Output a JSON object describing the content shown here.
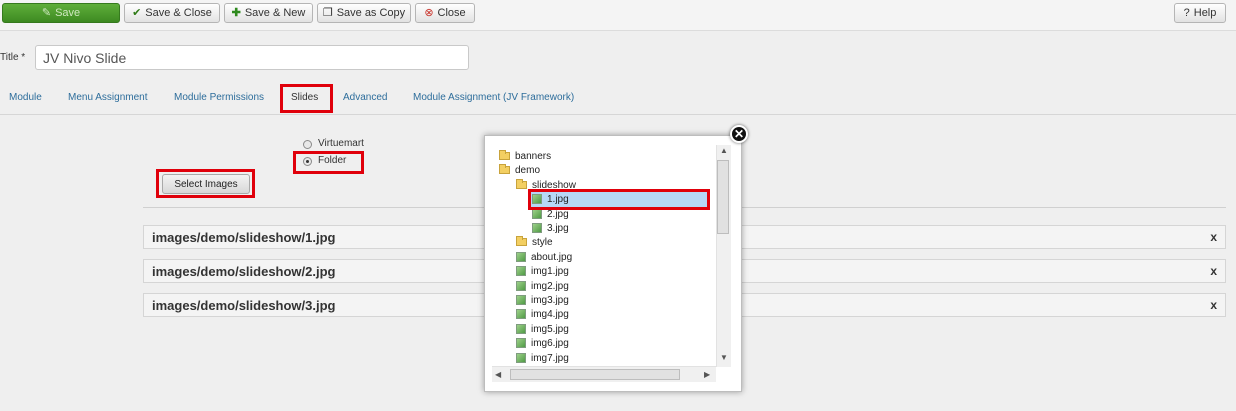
{
  "toolbar": {
    "save_label": "Save",
    "save_close_label": "Save & Close",
    "save_new_label": "Save & New",
    "save_copy_label": "Save as Copy",
    "close_label": "Close",
    "help_label": "Help"
  },
  "title": {
    "label": "Title *",
    "value": "JV Nivo Slide"
  },
  "tabs": [
    "Module",
    "Menu Assignment",
    "Module Permissions",
    "Slides",
    "Advanced",
    "Module Assignment (JV Framework)"
  ],
  "source": {
    "option1": "Virtuemart",
    "option2": "Folder",
    "selected": "Folder"
  },
  "select_button_label": "Select Images",
  "images": [
    "images/demo/slideshow/1.jpg",
    "images/demo/slideshow/2.jpg",
    "images/demo/slideshow/3.jpg"
  ],
  "remove_label": "x",
  "tree": [
    "banners",
    "demo",
    "slideshow",
    "1.jpg",
    "2.jpg",
    "3.jpg",
    "style",
    "about.jpg",
    "img1.jpg",
    "img2.jpg",
    "img3.jpg",
    "img4.jpg",
    "img5.jpg",
    "img6.jpg",
    "img7.jpg"
  ],
  "selected_file": "1.jpg",
  "colors": {
    "highlight": "#e0000b",
    "save_green": "#3d8a22",
    "link_blue": "#2d6d9b",
    "selection": "#b7d7f6"
  }
}
